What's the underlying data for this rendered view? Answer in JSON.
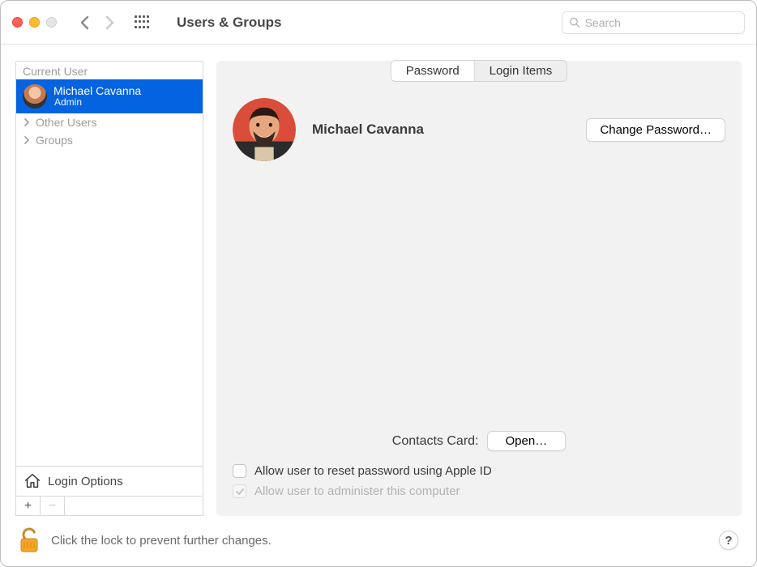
{
  "window": {
    "title": "Users & Groups"
  },
  "search": {
    "placeholder": "Search"
  },
  "sidebar": {
    "currentUserHeader": "Current User",
    "user": {
      "name": "Michael Cavanna",
      "role": "Admin"
    },
    "otherUsers": "Other Users",
    "groups": "Groups",
    "loginOptions": "Login Options"
  },
  "tabs": {
    "password": "Password",
    "loginItems": "Login Items"
  },
  "profile": {
    "name": "Michael Cavanna",
    "changePassword": "Change Password…"
  },
  "contacts": {
    "label": "Contacts Card:",
    "open": "Open…"
  },
  "checks": {
    "resetApple": "Allow user to reset password using Apple ID",
    "administer": "Allow user to administer this computer"
  },
  "footer": {
    "lockText": "Click the lock to prevent further changes.",
    "help": "?"
  },
  "buttons": {
    "add": "+",
    "remove": "−"
  }
}
